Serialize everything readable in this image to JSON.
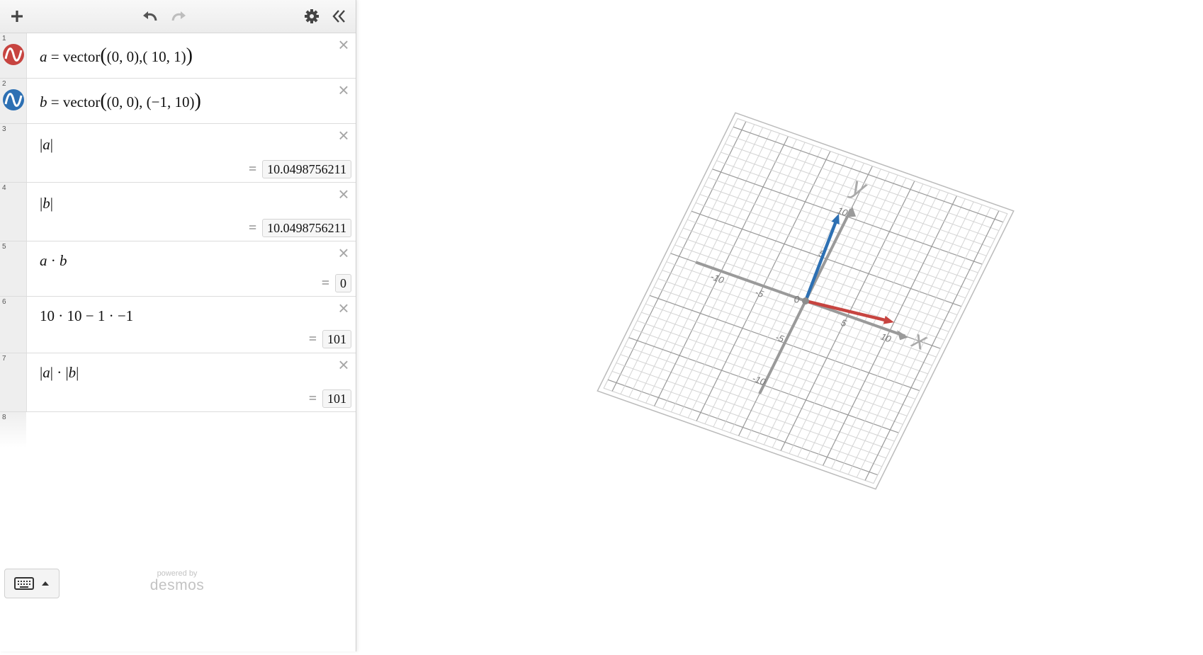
{
  "colors": {
    "vector_a": "#c74440",
    "vector_b": "#2d70b3",
    "axis": "#9a9a9a",
    "grid": "#cccccc"
  },
  "toolbar": {
    "add_icon": "plus-icon",
    "undo_icon": "undo-icon",
    "redo_icon": "redo-icon",
    "settings_icon": "gear-icon",
    "collapse_icon": "double-chevron-left-icon"
  },
  "expressions": [
    {
      "number": "1",
      "a1": "a",
      "a2": " = vector",
      "a3": "(",
      "a4": "(0, 0)",
      "a5": ",( 10, 1)",
      "a6": ")"
    },
    {
      "number": "2",
      "a1": "b",
      "a2": " = vector",
      "a3": "(",
      "a4": "(0, 0)",
      "a5": ", (−1, 10)",
      "a6": ")"
    },
    {
      "number": "3",
      "p1": "|",
      "v": "a",
      "p2": "|",
      "eq": "=",
      "result": "10.0498756211"
    },
    {
      "number": "4",
      "p1": "|",
      "v": "b",
      "p2": "|",
      "eq": "=",
      "result": "10.0498756211"
    },
    {
      "number": "5",
      "l": "a",
      "m": " · ",
      "r": "b",
      "eq": "=",
      "result": "0"
    },
    {
      "number": "6",
      "latex": "10 · 10 − 1 · −1",
      "eq": "=",
      "result": "101"
    },
    {
      "number": "7",
      "p1": "|",
      "v1": "a",
      "p2": "|",
      "m": " · ",
      "p3": "|",
      "v2": "b",
      "p4": "|",
      "eq": "=",
      "result": "101"
    },
    {
      "number": "8"
    }
  ],
  "footer": {
    "powered_by": "powered by",
    "brand": "desmos",
    "keyboard_icon": "keyboard-icon",
    "caret_icon": "caret-up-icon"
  },
  "graph3d": {
    "x_label": "x",
    "y_label": "y",
    "origin_label": "0",
    "x_ticks": [
      "-10",
      "-5",
      "5",
      "10"
    ],
    "y_ticks": [
      "-10",
      "-5",
      "5",
      "10"
    ]
  },
  "chart_data": {
    "type": "scatter",
    "title": "",
    "xlabel": "x",
    "ylabel": "y",
    "xlim": [
      -10,
      10
    ],
    "ylim": [
      -10,
      10
    ],
    "grid": true,
    "series": [
      {
        "name": "a",
        "color": "#c74440",
        "x": [
          0,
          10
        ],
        "y": [
          0,
          1
        ]
      },
      {
        "name": "b",
        "color": "#2d70b3",
        "x": [
          0,
          -1
        ],
        "y": [
          0,
          10
        ]
      }
    ]
  }
}
